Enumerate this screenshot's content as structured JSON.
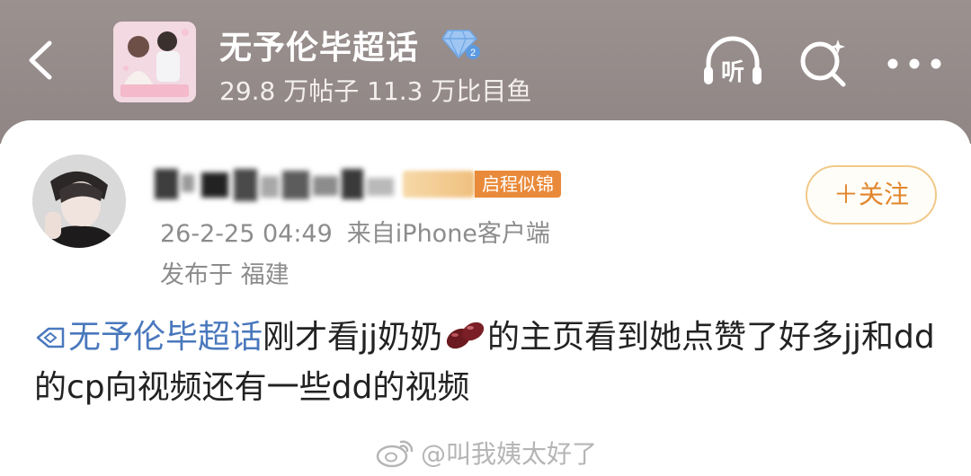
{
  "header": {
    "back_icon": "chevron-left-icon",
    "topic_title": "无予伦毕超话",
    "level_badge_icon": "diamond-level-icon",
    "level_badge_number": "2",
    "stats": "29.8 万帖子 11.3 万比目鱼",
    "listen_label": "听",
    "search_icon": "search-sparkle-icon",
    "more_icon": "more-dots-icon"
  },
  "post": {
    "author_badge": "启程似锦",
    "timestamp": "26-2-25 04:49",
    "source": "来自iPhone客户端",
    "location": "发布于 福建",
    "follow_label": "＋关注",
    "topic_link": "无予伦毕超话",
    "text_part1": "刚才看jj奶奶",
    "text_part2": "的主页看到她点赞了好多jj和dd的cp向视频还有一些dd的视频"
  },
  "watermark": "@叫我姨太好了",
  "colors": {
    "header_bg": "#948a89",
    "link_blue": "#4a78bd",
    "follow_orange": "#e2862c",
    "badge_orange": "#e98a3a",
    "meta_gray": "#8c8c8c"
  }
}
